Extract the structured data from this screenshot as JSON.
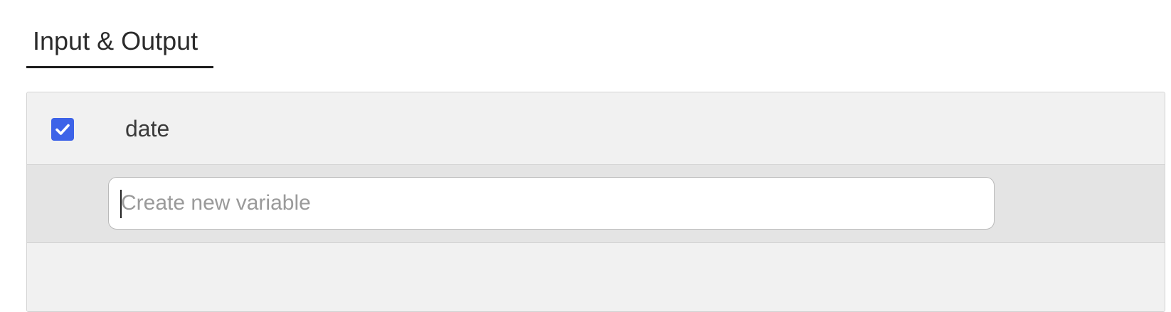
{
  "tabs": [
    {
      "label": "Input & Output",
      "active": true
    }
  ],
  "variables": [
    {
      "name": "date",
      "checked": true
    }
  ],
  "new_variable": {
    "placeholder": "Create new variable",
    "value": ""
  },
  "colors": {
    "checkbox": "#3d63e8",
    "tab_underline": "#1c1c1c",
    "panel_bg": "#f1f1f1",
    "input_row_bg": "#e4e4e4"
  }
}
